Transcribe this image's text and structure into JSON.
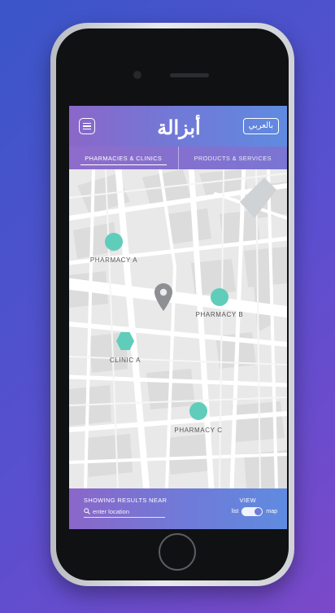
{
  "header": {
    "logo_text": "أبزالة",
    "language_button": "بالعربي"
  },
  "tabs": [
    {
      "label": "PHARMACIES & CLINICS",
      "active": true
    },
    {
      "label": "PRODUCTS & SERVICES",
      "active": false
    }
  ],
  "map": {
    "markers": [
      {
        "label": "PHARMACY A",
        "shape": "circle"
      },
      {
        "label": "PHARMACY B",
        "shape": "circle"
      },
      {
        "label": "CLINIC A",
        "shape": "hexagon"
      },
      {
        "label": "PHARMACY C",
        "shape": "circle"
      }
    ],
    "marker_color": "#5fcdb9",
    "current_location_icon": "location-pin-icon"
  },
  "footer": {
    "results_label": "SHOWING RESULTS NEAR",
    "location_placeholder": "enter location",
    "view_label": "VIEW",
    "toggle_left": "list",
    "toggle_right": "map",
    "selected_view": "map"
  },
  "colors": {
    "background": "#4a55cc",
    "header_gradient_start": "#8a67c9",
    "header_gradient_end": "#5f8be0",
    "marker": "#5fcdb9"
  }
}
